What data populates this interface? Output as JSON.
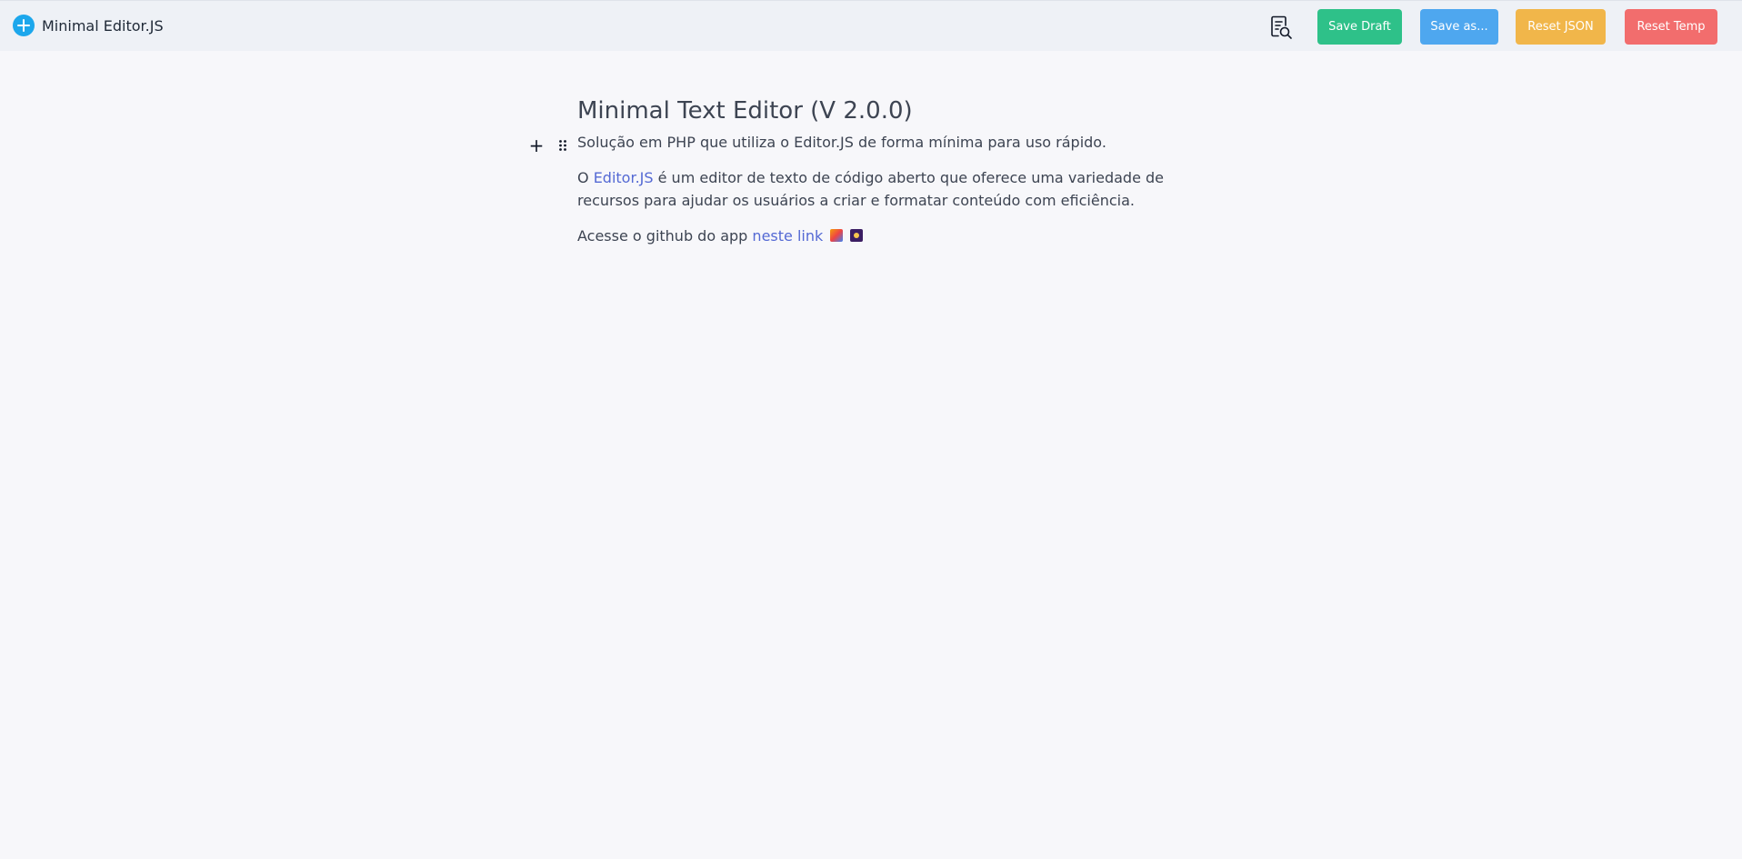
{
  "header": {
    "title": "Minimal Editor.JS",
    "logo_icon": "plus-circle-icon",
    "preview_icon": "document-search-icon",
    "buttons": {
      "save_draft": "Save Draft",
      "save_as": "Save as...",
      "reset_json": "Reset JSON",
      "reset_temp": "Reset Temp"
    }
  },
  "colors": {
    "save_draft": "#2ec189",
    "save_as": "#4ea7ef",
    "reset_json": "#f1b64a",
    "reset_temp": "#f26d6d",
    "link": "#5469d4",
    "logo": "#1ca7ec"
  },
  "editor": {
    "heading": "Minimal Text Editor (V 2.0.0)",
    "paragraph1": "Solução em PHP que utiliza o Editor.JS de forma mínima para uso rápido.",
    "paragraph2": {
      "prefix": "O ",
      "link_text": "Editor.JS",
      "suffix": " é um editor de texto de código aberto que oferece uma variedade de recursos para ajudar os usuários a criar e formatar conteúdo com eficiência."
    },
    "paragraph3": {
      "prefix": "Acesse o github do app ",
      "link_text": "neste link"
    },
    "emoji_icons": [
      "party-emoji-icon",
      "sparkle-emoji-icon"
    ],
    "toolbar": {
      "add_icon": "plus-icon",
      "drag_icon": "drag-handle-icon",
      "add_glyph": "+"
    }
  }
}
